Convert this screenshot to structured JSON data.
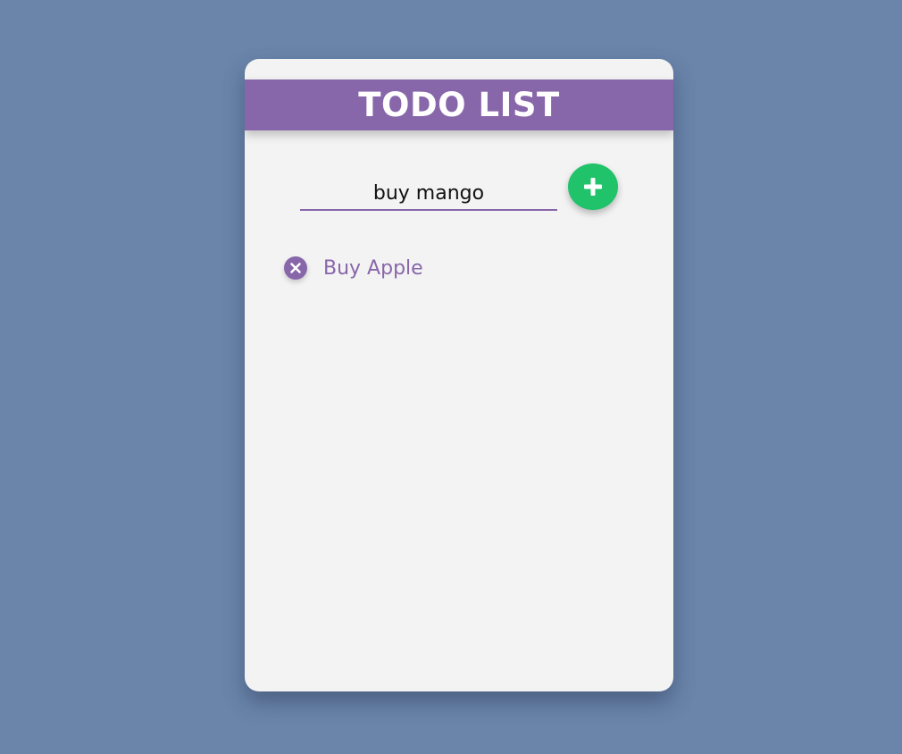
{
  "app": {
    "title": "TODO LIST"
  },
  "input": {
    "value": "buy mango",
    "placeholder": ""
  },
  "add_button": {
    "icon": "plus-icon"
  },
  "todos": [
    {
      "label": "Buy Apple",
      "icon": "close-circle-icon"
    }
  ],
  "colors": {
    "background": "#6a84aa",
    "card": "#f3f3f3",
    "accent": "#8866aa",
    "add_button": "#20c26a"
  }
}
